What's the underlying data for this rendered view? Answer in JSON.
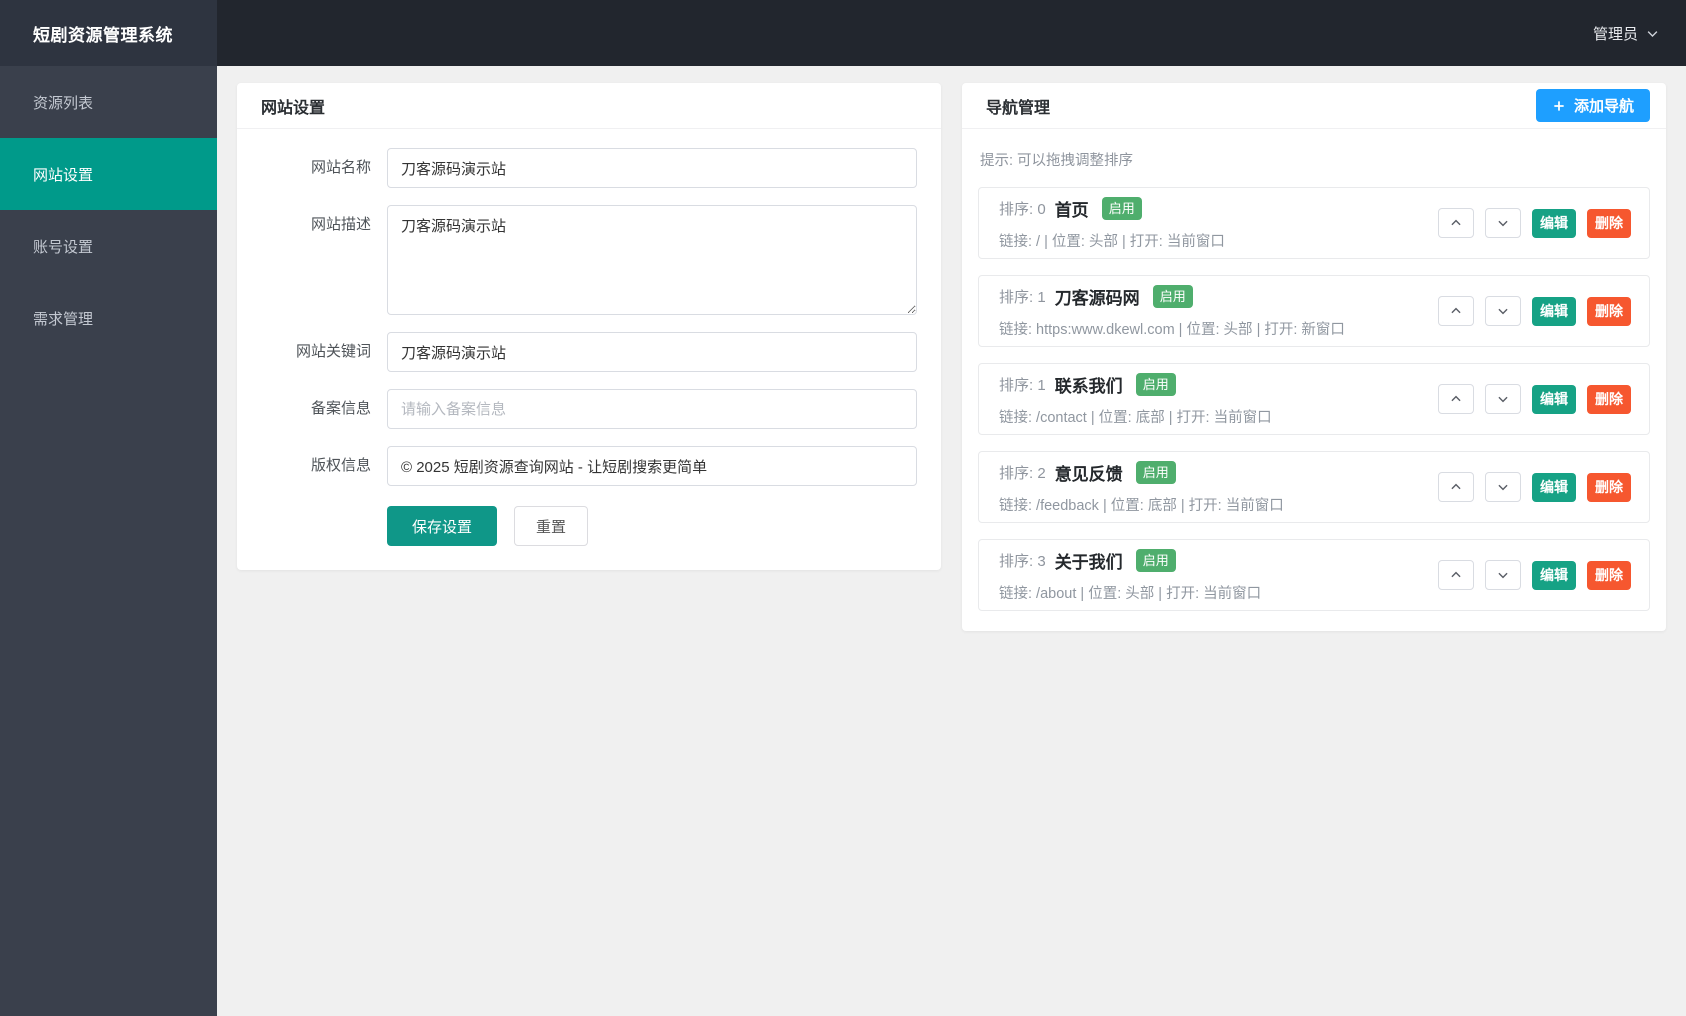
{
  "app": {
    "title": "短剧资源管理系统",
    "user": "管理员"
  },
  "sidebar": {
    "items": [
      {
        "label": "资源列表",
        "active": false
      },
      {
        "label": "网站设置",
        "active": true
      },
      {
        "label": "账号设置",
        "active": false
      },
      {
        "label": "需求管理",
        "active": false
      }
    ]
  },
  "site_settings": {
    "title": "网站设置",
    "fields": [
      {
        "label": "网站名称",
        "type": "input",
        "value": "刀客源码演示站"
      },
      {
        "label": "网站描述",
        "type": "textarea",
        "value": "刀客源码演示站"
      },
      {
        "label": "网站关键词",
        "type": "input",
        "value": "刀客源码演示站"
      },
      {
        "label": "备案信息",
        "type": "input",
        "value": "",
        "placeholder": "请输入备案信息"
      },
      {
        "label": "版权信息",
        "type": "input",
        "value": "© 2025 短剧资源查询网站 - 让短剧搜索更简单"
      }
    ],
    "save_label": "保存设置",
    "reset_label": "重置"
  },
  "nav_manager": {
    "title": "导航管理",
    "add_label": "添加导航",
    "hint": "提示: 可以拖拽调整排序",
    "edit_label": "编辑",
    "delete_label": "删除",
    "items": [
      {
        "sort_text": "排序: 0",
        "name": "首页",
        "status": "启用",
        "meta": "链接: / | 位置: 头部 | 打开: 当前窗口"
      },
      {
        "sort_text": "排序: 1",
        "name": "刀客源码网",
        "status": "启用",
        "meta": "链接: https:www.dkewl.com | 位置: 头部 | 打开: 新窗口"
      },
      {
        "sort_text": "排序: 1",
        "name": "联系我们",
        "status": "启用",
        "meta": "链接: /contact | 位置: 底部 | 打开: 当前窗口"
      },
      {
        "sort_text": "排序: 2",
        "name": "意见反馈",
        "status": "启用",
        "meta": "链接: /feedback | 位置: 底部 | 打开: 当前窗口"
      },
      {
        "sort_text": "排序: 3",
        "name": "关于我们",
        "status": "启用",
        "meta": "链接: /about | 位置: 头部 | 打开: 当前窗口"
      }
    ]
  },
  "colors": {
    "page-bg": "#f0f0f0",
    "topbar-bg": "#22262e",
    "brand-bg": "#2e3440",
    "sidebar-bg": "#3a404c",
    "sidebar-active": "#009a8a",
    "save-teal": "#0f9788",
    "edit-teal": "#16a285",
    "add-blue": "#1e9fff",
    "delete-orange": "#f6572f",
    "badge-green": "#4fae6d"
  }
}
